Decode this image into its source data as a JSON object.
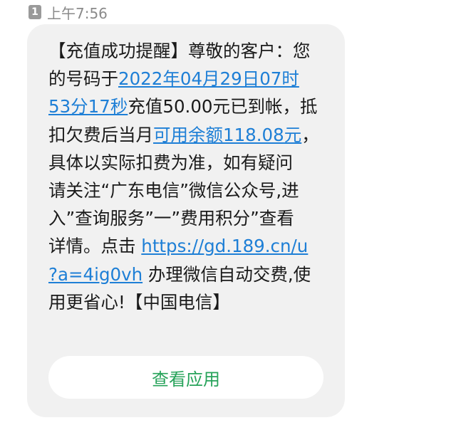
{
  "status": {
    "sim_label": "1",
    "time": "上午7:56"
  },
  "message": {
    "line1": "【充值成功提醒】尊敬的客户：您",
    "line2_prefix": "的号码于",
    "line2_link": "2022年04月29日07时",
    "line3_link": "53分17秒",
    "line3_suffix": "充值50.00元已到帐，抵",
    "line4_prefix": "扣欠费后当月",
    "line4_link": "可用余额118.08元",
    "line4_suffix": "，",
    "line5": "具体以实际扣费为准，如有疑问",
    "line6": "请关注“广东电信”微信公众号,进",
    "line7": "入”查询服务”一”费用积分”查看",
    "line8_prefix": "详情。点击 ",
    "line8_link": "https://gd.189.cn/u",
    "line9_link": "?a=4ig0vh",
    "line9_suffix": " 办理微信自动交费,使",
    "line10": "用更省心!【中国电信】"
  },
  "action_button": {
    "label": "查看应用"
  },
  "colors": {
    "link": "#1e7fd6",
    "button_text": "#27a35a",
    "bubble_bg": "#f1f1f1"
  }
}
